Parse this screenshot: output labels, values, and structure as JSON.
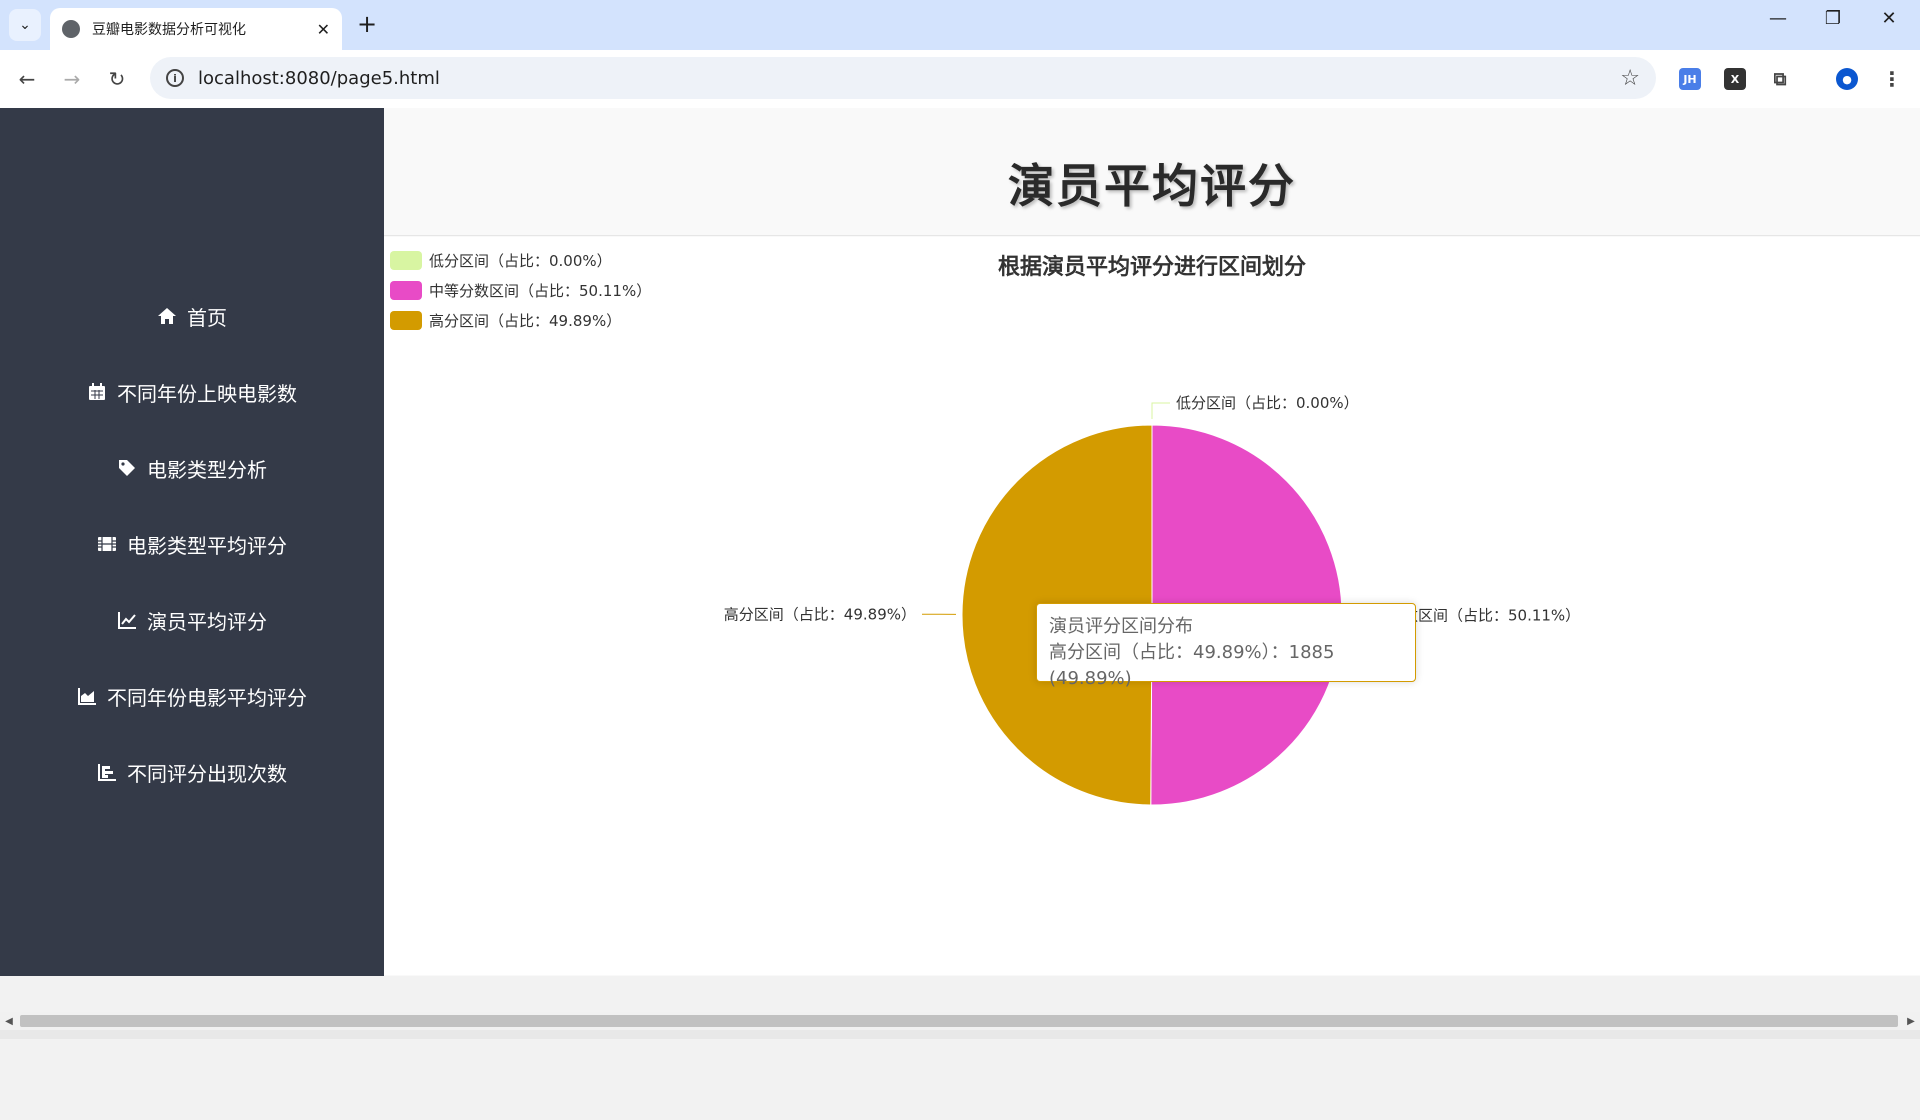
{
  "browser": {
    "tab_title": "豆瓣电影数据分析可视化",
    "url": "localhost:8080/page5.html",
    "extensions": [
      "JH",
      "X"
    ]
  },
  "sidebar": {
    "items": [
      {
        "label": "首页",
        "icon": "home-icon"
      },
      {
        "label": "不同年份上映电影数",
        "icon": "calendar-icon"
      },
      {
        "label": "电影类型分析",
        "icon": "tag-icon"
      },
      {
        "label": "电影类型平均评分",
        "icon": "film-icon"
      },
      {
        "label": "演员平均评分",
        "icon": "line-chart-icon"
      },
      {
        "label": "不同年份电影平均评分",
        "icon": "area-chart-icon"
      },
      {
        "label": "不同评分出现次数",
        "icon": "bar-chart-icon"
      }
    ]
  },
  "header": {
    "title": "演员平均评分"
  },
  "chart_data": {
    "type": "pie",
    "title": "根据演员平均评分进行区间划分",
    "series_name": "演员评分区间分布",
    "legend_position": "top-left",
    "slices": [
      {
        "name": "低分区间（占比：0.00%）",
        "value": 0,
        "percent": 0.0,
        "color": "#d8f5a2"
      },
      {
        "name": "中等分数区间（占比：50.11%）",
        "value": 1893,
        "percent": 50.11,
        "color": "#e84bc6"
      },
      {
        "name": "高分区间（占比：49.89%）",
        "value": 1885,
        "percent": 49.89,
        "color": "#d39b00"
      }
    ],
    "outer_labels": {
      "low": "低分区间（占比：0.00%）",
      "mid": "分数区间（占比：50.11%）",
      "high": "高分区间（占比：49.89%）"
    }
  },
  "tooltip": {
    "title": "演员评分区间分布",
    "body": "高分区间（占比：49.89%）：1885 (49.89%)"
  }
}
